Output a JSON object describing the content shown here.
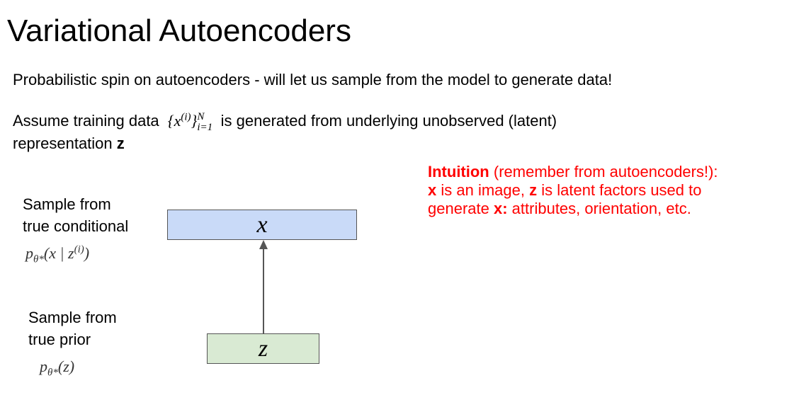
{
  "title": "Variational Autoencoders",
  "line1": "Probabilistic spin on autoencoders - will let us sample from the model to generate data!",
  "line2": {
    "before": "Assume training data",
    "math_set": "{x",
    "math_sup": "(i)",
    "math_close": "}",
    "math_sub": "i=1",
    "math_supN": "N",
    "after": "is generated from underlying unobserved (latent)",
    "cont": "representation",
    "bold_z": "z"
  },
  "intuition": {
    "head": "Intuition",
    "head_rest": "(remember from autoencoders!):",
    "l2_x": "x",
    "l2_a": "is an image,",
    "l2_z": "z",
    "l2_b": "is latent factors used to",
    "l3_a": "generate",
    "l3_x": "x:",
    "l3_b": "attributes, orientation, etc."
  },
  "diagram": {
    "top_label_1": "Sample from",
    "top_label_2": "true conditional",
    "top_dist": "p",
    "top_dist_sub": "θ*",
    "top_dist_arg": "(x | z",
    "top_dist_sup": "(i)",
    "top_dist_close": ")",
    "bottom_label_1": "Sample from",
    "bottom_label_2": "true prior",
    "bottom_dist": "p",
    "bottom_dist_sub": "θ*",
    "bottom_dist_arg": "(z)",
    "box_x": "x",
    "box_z": "z",
    "box_x_color": "#c9daf8",
    "box_z_color": "#d9ead3",
    "arrow_color": "#555555"
  }
}
